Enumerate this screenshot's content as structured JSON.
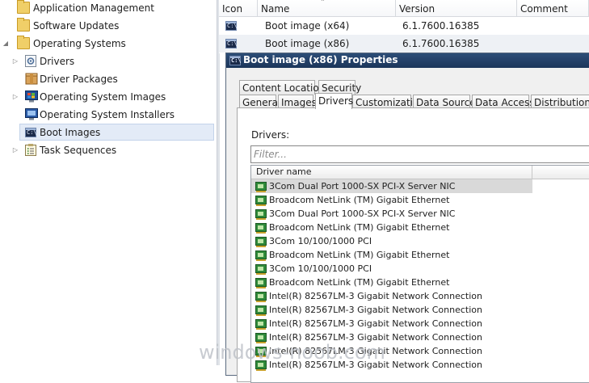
{
  "tree": {
    "items": [
      {
        "label": "Application Management",
        "icon": "folder-icon"
      },
      {
        "label": "Software Updates",
        "icon": "folder-icon"
      },
      {
        "label": "Operating Systems",
        "icon": "folder-icon"
      },
      {
        "label": "Drivers",
        "icon": "driver-icon"
      },
      {
        "label": "Driver Packages",
        "icon": "driver-package-icon"
      },
      {
        "label": "Operating System Images",
        "icon": "os-image-icon"
      },
      {
        "label": "Operating System Installers",
        "icon": "os-installer-icon"
      },
      {
        "label": "Boot Images",
        "icon": "boot-image-icon"
      },
      {
        "label": "Task Sequences",
        "icon": "task-sequence-icon"
      }
    ],
    "selected": "Boot Images"
  },
  "list": {
    "columns": [
      "Icon",
      "Name",
      "Version",
      "Comment"
    ],
    "rows": [
      {
        "name": "Boot image (x64)",
        "version": "6.1.7600.16385",
        "comment": ""
      },
      {
        "name": "Boot image (x86)",
        "version": "6.1.7600.16385",
        "comment": ""
      }
    ]
  },
  "dialog": {
    "title": "Boot image (x86) Properties",
    "tabs_row1": [
      "Content Locations",
      "Security"
    ],
    "tabs_row2": [
      "General",
      "Images",
      "Drivers",
      "Customization",
      "Data Source",
      "Data Access",
      "Distribution Se"
    ],
    "active_tab": "Drivers",
    "drivers_label": "Drivers:",
    "filter_placeholder": "Filter...",
    "grid_header": "Driver name",
    "drivers": [
      "3Com Dual Port 1000-SX PCI-X Server NIC",
      "Broadcom NetLink (TM) Gigabit Ethernet",
      "3Com Dual Port 1000-SX PCI-X Server NIC",
      "Broadcom NetLink (TM) Gigabit Ethernet",
      "3Com 10/100/1000 PCI",
      "Broadcom NetLink (TM) Gigabit Ethernet",
      "3Com 10/100/1000 PCI",
      "Broadcom NetLink (TM) Gigabit Ethernet",
      "Intel(R) 82567LM-3 Gigabit Network Connection",
      "Intel(R) 82567LM-3 Gigabit Network Connection",
      "Intel(R) 82567LM-3 Gigabit Network Connection",
      "Intel(R) 82567LM-3 Gigabit Network Connection",
      "Intel(R) 82567LM-3 Gigabit Network Connection",
      "Intel(R) 82567LM-3 Gigabit Network Connection"
    ]
  },
  "watermark": "windows-noob.com",
  "colors": {
    "title_bar": "#1f3b63",
    "selection": "#e3ebf7",
    "folder": "#f0cf68"
  }
}
